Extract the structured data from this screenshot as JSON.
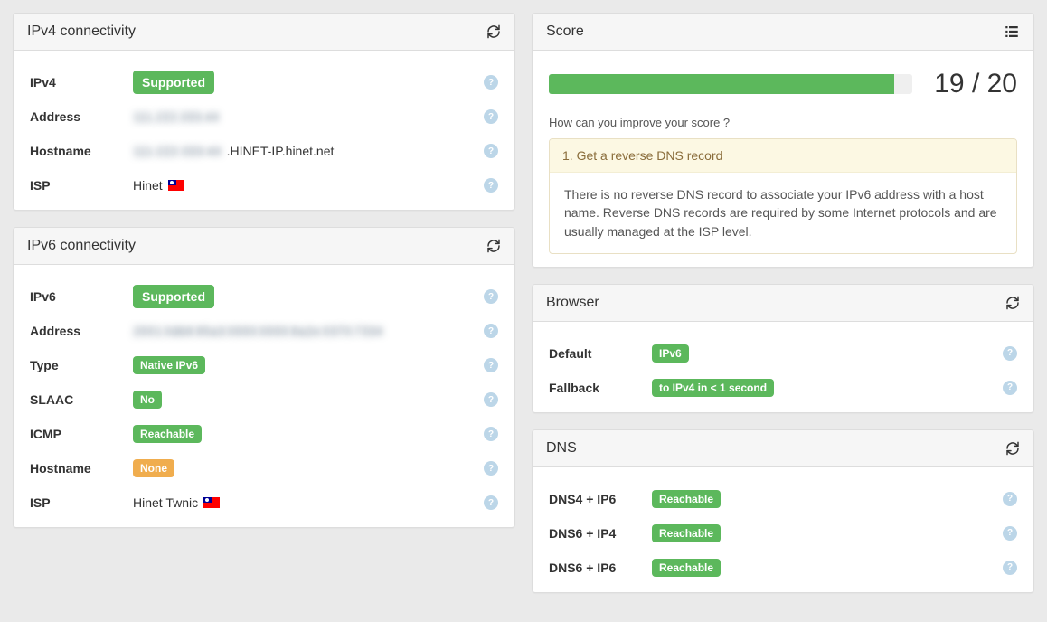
{
  "chart_data": {
    "type": "bar",
    "title": "Score",
    "categories": [
      "Score"
    ],
    "values": [
      19
    ],
    "ylim": [
      0,
      20
    ],
    "xlabel": "",
    "ylabel": ""
  },
  "ipv4": {
    "title": "IPv4 connectivity",
    "rows": {
      "ipv4": {
        "label": "IPv4",
        "badge": "Supported"
      },
      "address": {
        "label": "Address",
        "value": "111.222.333.44"
      },
      "hostname": {
        "label": "Hostname",
        "blurred": "111-222-333-44",
        "suffix": ".HINET-IP.hinet.net"
      },
      "isp": {
        "label": "ISP",
        "value": "Hinet"
      }
    }
  },
  "ipv6": {
    "title": "IPv6 connectivity",
    "rows": {
      "ipv6": {
        "label": "IPv6",
        "badge": "Supported"
      },
      "address": {
        "label": "Address",
        "value": "2001:0db8:85a3:0000:0000:8a2e:0370:7334"
      },
      "type": {
        "label": "Type",
        "badge": "Native IPv6"
      },
      "slaac": {
        "label": "SLAAC",
        "badge": "No"
      },
      "icmp": {
        "label": "ICMP",
        "badge": "Reachable"
      },
      "hostname": {
        "label": "Hostname",
        "badge": "None"
      },
      "isp": {
        "label": "ISP",
        "value": "Hinet Twnic"
      }
    }
  },
  "score": {
    "title": "Score",
    "value": 19,
    "max": 20,
    "display": "19 / 20",
    "question": "How can you improve your score ?",
    "tip_title": "1. Get a reverse DNS record",
    "tip_body": "There is no reverse DNS record to associate your IPv6 address with a host name. Reverse DNS records are required by some Internet protocols and are usually managed at the ISP level."
  },
  "browser": {
    "title": "Browser",
    "rows": {
      "default": {
        "label": "Default",
        "badge": "IPv6"
      },
      "fallback": {
        "label": "Fallback",
        "badge": "to IPv4 in < 1 second"
      }
    }
  },
  "dns": {
    "title": "DNS",
    "rows": [
      {
        "label": "DNS4 + IP6",
        "badge": "Reachable"
      },
      {
        "label": "DNS6 + IP4",
        "badge": "Reachable"
      },
      {
        "label": "DNS6 + IP6",
        "badge": "Reachable"
      }
    ]
  }
}
